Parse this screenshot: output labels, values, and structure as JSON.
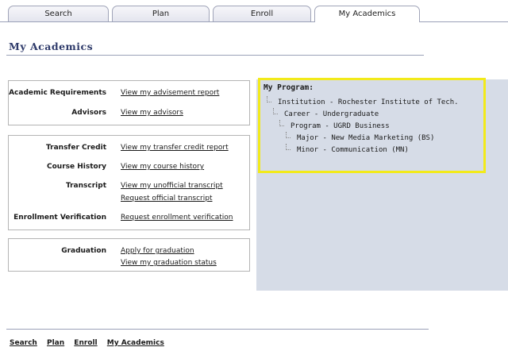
{
  "tabs": {
    "search": "Search",
    "plan": "Plan",
    "enroll": "Enroll",
    "my_academics": "My Academics"
  },
  "page_title": "My Academics",
  "boxes": {
    "box1": {
      "academic_requirements_label": "Academic Requirements",
      "academic_requirements_link": "View my advisement report",
      "advisors_label": "Advisors",
      "advisors_link": "View my advisors"
    },
    "box2": {
      "transfer_credit_label": "Transfer Credit",
      "transfer_credit_link": "View my transfer credit report",
      "course_history_label": "Course History",
      "course_history_link": "View my course history",
      "transcript_label": "Transcript",
      "transcript_link1": "View my unofficial transcript",
      "transcript_link2": "Request official transcript",
      "enrollment_verification_label": "Enrollment Verification",
      "enrollment_verification_link": "Request enrollment verification"
    },
    "box3": {
      "graduation_label": "Graduation",
      "graduation_link1": "Apply for graduation",
      "graduation_link2": "View my graduation status"
    }
  },
  "program": {
    "title": "My Program:",
    "institution": "Institution - Rochester Institute of Tech.",
    "career": "Career - Undergraduate",
    "program": "Program - UGRD Business",
    "major": "Major - New Media Marketing (BS)",
    "minor": "Minor - Communication (MN)"
  },
  "footer": {
    "search": "Search",
    "plan": "Plan",
    "enroll": "Enroll",
    "my_academics": "My Academics"
  },
  "colors": {
    "highlight": "#f2ea1a",
    "panel": "#d6dce7"
  }
}
